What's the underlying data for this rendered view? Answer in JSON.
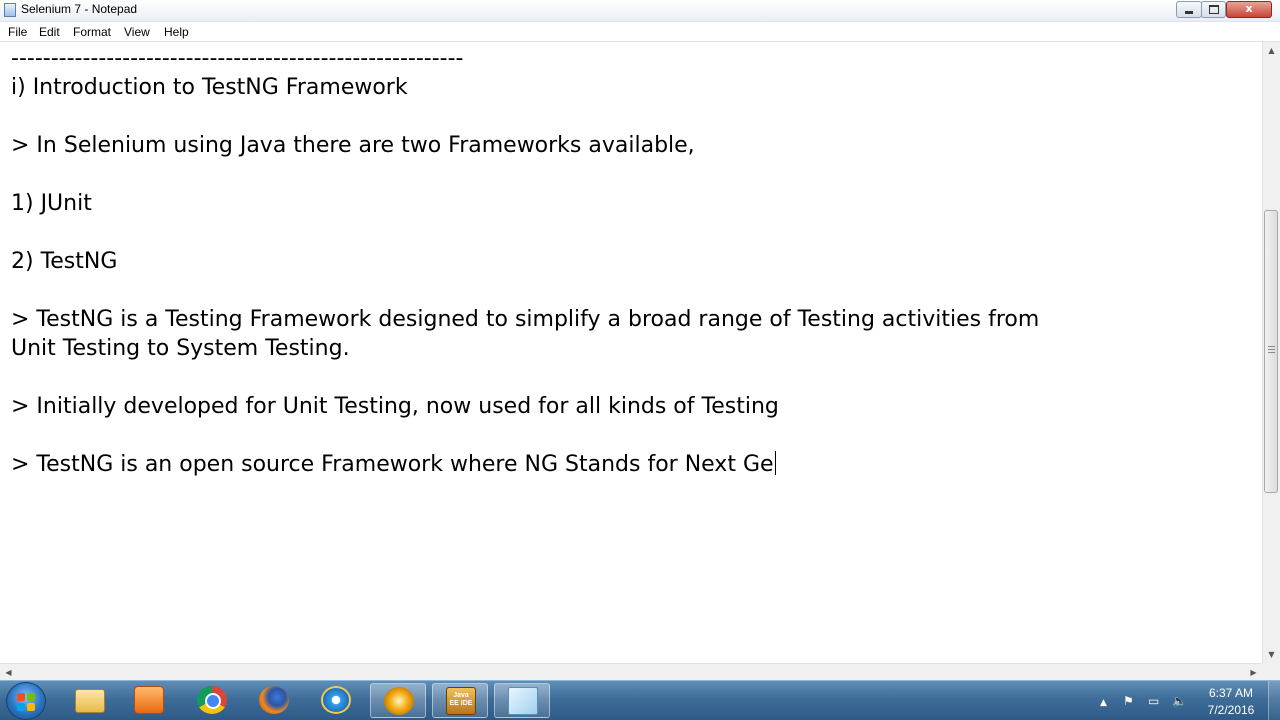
{
  "window": {
    "title": "Selenium 7 - Notepad",
    "minimize_glyph": "",
    "maximize_glyph": "",
    "close_glyph": "x"
  },
  "menu": {
    "file": "File",
    "edit": "Edit",
    "format": "Format",
    "view": "View",
    "help": "Help"
  },
  "editor": {
    "lines": [
      "---------------------------------------------------------",
      "i) Introduction to TestNG Framework",
      "",
      "> In Selenium using Java there are two Frameworks available,",
      "",
      "1) JUnit",
      "",
      "2) TestNG",
      "",
      "> TestNG is a Testing Framework designed to simplify a broad range of Testing activities from",
      "Unit Testing to System Testing.",
      "",
      "> Initially developed for Unit Testing, now used for all kinds of Testing",
      "",
      "> TestNG is an open source Framework where NG Stands for Next Ge"
    ]
  },
  "scrollbars": {
    "vertical_position": 0.27,
    "horizontal_position": 0.0
  },
  "taskbar": {
    "pinned_apps": [
      {
        "name": "windows-explorer",
        "icon": "folder-icon"
      },
      {
        "name": "media-player",
        "icon": "media-player-icon"
      },
      {
        "name": "google-chrome",
        "icon": "chrome-icon"
      },
      {
        "name": "firefox",
        "icon": "firefox-icon"
      },
      {
        "name": "internet-explorer",
        "icon": "ie-icon"
      },
      {
        "name": "flower-app",
        "icon": "flower-icon"
      },
      {
        "name": "eclipse-java-ee",
        "icon": "java-ee-ide-icon"
      },
      {
        "name": "notepad",
        "icon": "notepad-icon",
        "active": true
      }
    ],
    "javaee_label": "Java EE IDE",
    "tray": {
      "up_arrow": "▲",
      "flag": "⚑",
      "network": "▭",
      "volume": "🔈"
    },
    "clock": {
      "time": "6:37 AM",
      "date": "7/2/2016"
    }
  },
  "colors": {
    "taskbar": "#3f6d99",
    "close_button": "#c7453a",
    "text": "#000000"
  }
}
